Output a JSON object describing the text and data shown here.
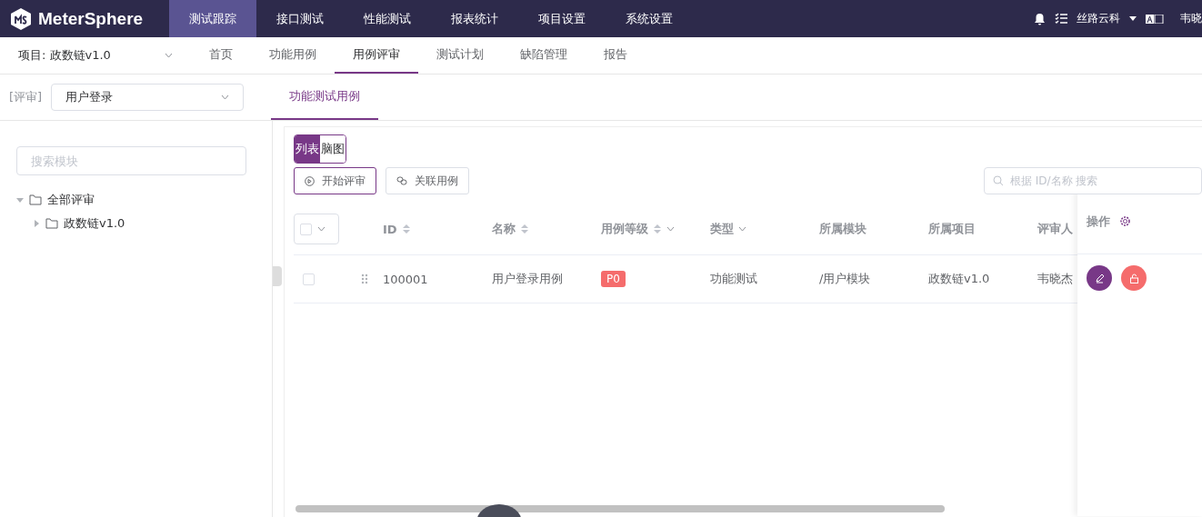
{
  "logo": {
    "text": "MeterSphere"
  },
  "top_nav": [
    {
      "label": "测试跟踪",
      "selected": true
    },
    {
      "label": "接口测试",
      "selected": false
    },
    {
      "label": "性能测试",
      "selected": false
    },
    {
      "label": "报表统计",
      "selected": false
    },
    {
      "label": "项目设置",
      "selected": false
    },
    {
      "label": "系统设置",
      "selected": false
    }
  ],
  "workspace": "丝路云科",
  "user": "韦晓",
  "project": "项目: 政数链v1.0",
  "sub_nav": [
    {
      "label": "首页",
      "selected": false
    },
    {
      "label": "功能用例",
      "selected": false
    },
    {
      "label": "用例评审",
      "selected": true
    },
    {
      "label": "测试计划",
      "selected": false
    },
    {
      "label": "缺陷管理",
      "selected": false
    },
    {
      "label": "报告",
      "selected": false
    }
  ],
  "review_label": "[评审]",
  "review_select": "用户登录",
  "content_tabs": [
    {
      "label": "功能测试用例",
      "selected": true
    }
  ],
  "sidebar": {
    "search": {
      "placeholder": "搜索模块"
    },
    "tree": [
      {
        "label": "全部评审",
        "expanded": true,
        "children": [
          {
            "label": "政数链v1.0",
            "expanded": false
          }
        ]
      }
    ]
  },
  "view_toggle": [
    {
      "label": "列表",
      "selected": true
    },
    {
      "label": "脑图",
      "selected": false
    }
  ],
  "buttons": [
    "开始评审",
    "关联用例"
  ],
  "search": {
    "placeholder": "根据 ID/名称 搜索"
  },
  "table": {
    "columns": [
      {
        "label": "ID",
        "sortable": true,
        "filter": false
      },
      {
        "label": "名称",
        "sortable": true,
        "filter": false
      },
      {
        "label": "用例等级",
        "sortable": true,
        "filter": true
      },
      {
        "label": "类型",
        "sortable": false,
        "filter": true
      },
      {
        "label": "所属模块",
        "sortable": false,
        "filter": false
      },
      {
        "label": "所属项目",
        "sortable": false,
        "filter": false
      },
      {
        "label": "评审人",
        "sortable": false,
        "filter": false
      }
    ],
    "action_column": "操作",
    "select_all": {
      "checked": false
    },
    "rows": [
      {
        "checked": false,
        "id": "100001",
        "name": "用户登录用例",
        "priority": "P0",
        "type": "功能测试",
        "module": "/用户模块",
        "project": "政数链v1.0",
        "reviewer": "韦晓杰"
      }
    ]
  }
}
